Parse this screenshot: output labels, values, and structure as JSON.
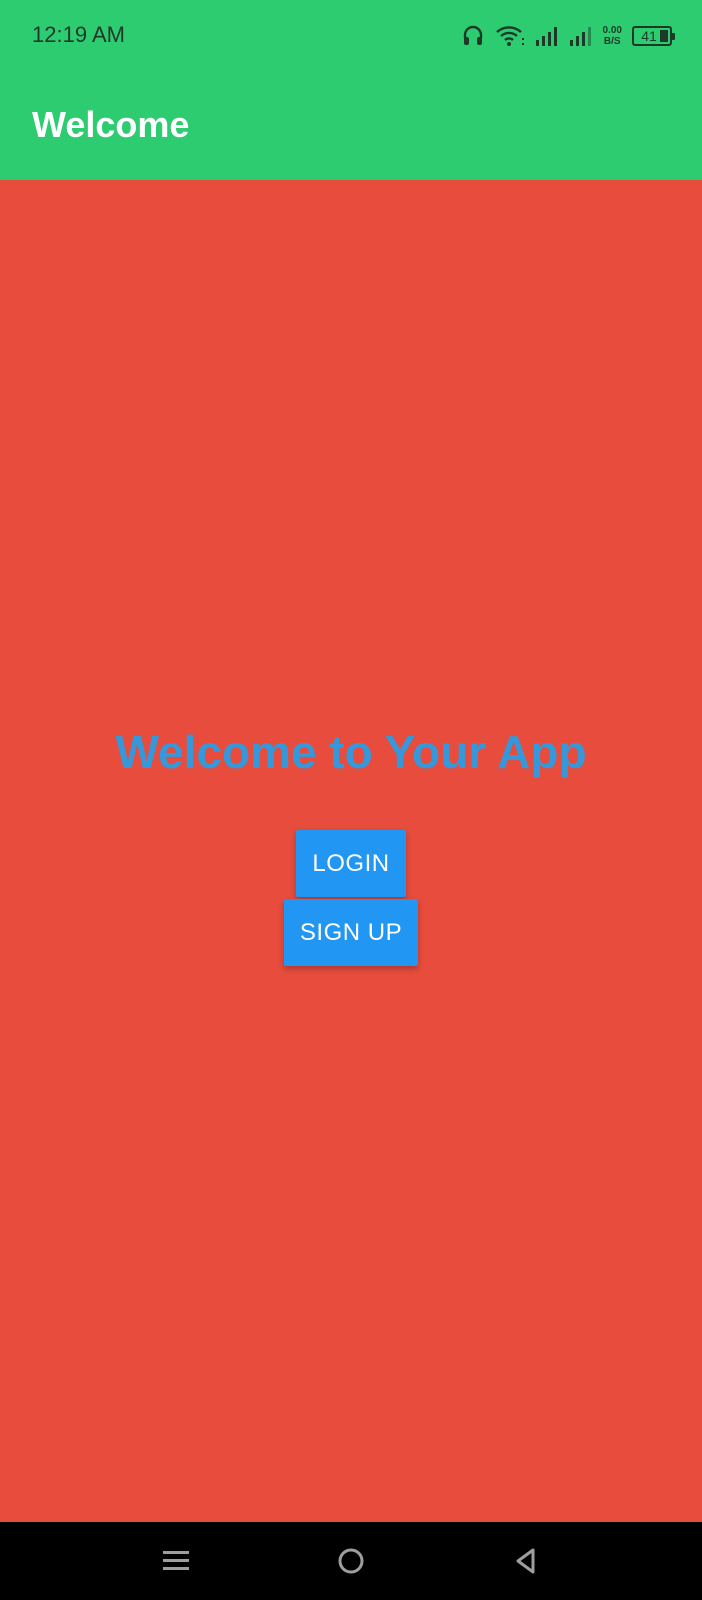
{
  "status_bar": {
    "time": "12:19 AM",
    "net_speed_value": "0.00",
    "net_speed_unit": "B/S",
    "battery": "41",
    "icons": [
      "headphones-icon",
      "wifi-icon",
      "signal-icon",
      "signal-icon",
      "battery-icon"
    ]
  },
  "app_bar": {
    "title": "Welcome"
  },
  "main": {
    "heading": "Welcome to Your App",
    "login_label": "LOGIN",
    "signup_label": "SIGN UP"
  },
  "nav": {
    "icons": [
      "menu-icon",
      "home-icon",
      "back-icon"
    ]
  },
  "colors": {
    "app_bar": "#2ECC71",
    "background": "#E74C3C",
    "heading": "#3498DB",
    "button": "#2196F3",
    "nav_bar": "#000000"
  }
}
